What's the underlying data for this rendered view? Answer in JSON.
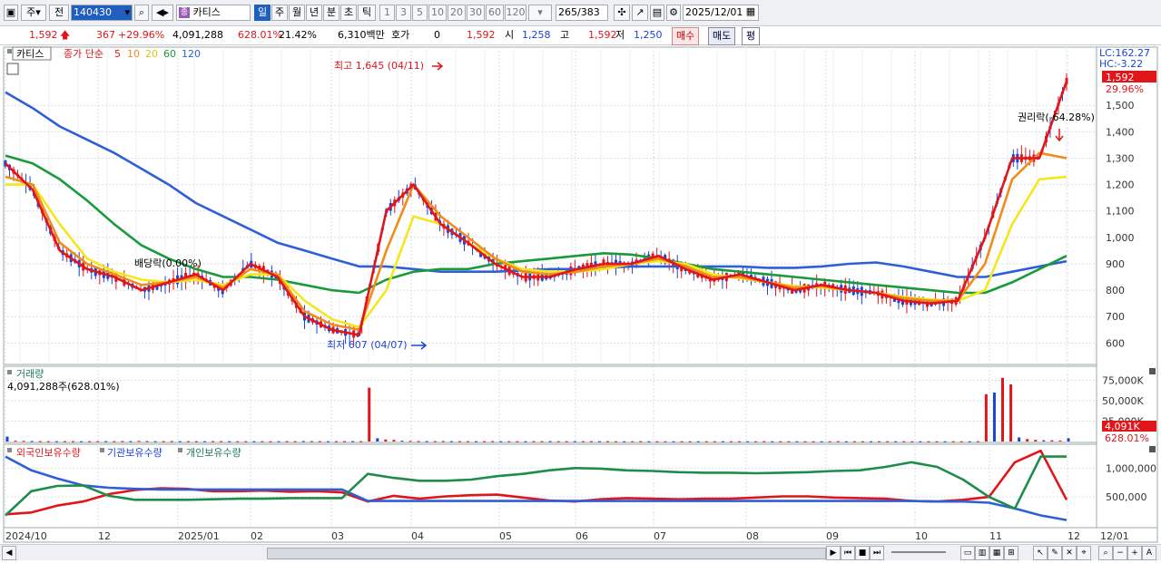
{
  "toolbar": {
    "mode1": "주",
    "mode2": "전",
    "code": "140430",
    "name": "카티스",
    "periods": [
      "일",
      "주",
      "월",
      "년",
      "분",
      "초",
      "틱"
    ],
    "active_period": "일",
    "intervals": [
      "1",
      "3",
      "5",
      "10",
      "20",
      "30",
      "60",
      "120"
    ],
    "range": "265",
    "total": "/383",
    "date": "2025/12/01"
  },
  "info": {
    "price": "1,592",
    "change": "367",
    "change_pct": "+29.96%",
    "volume": "4,091,288",
    "volume_pct": "628.01%",
    "turnover": "21.42%",
    "amount": "6,310백만",
    "hoga_label": "호가",
    "hoga_value": "0",
    "price2": "1,592",
    "open_label": "시",
    "open": "1,258",
    "high_label": "고",
    "high": "1,592",
    "low_label": "저",
    "low": "1,250",
    "buy": "매수",
    "sell": "매도",
    "eval": "평"
  },
  "chart_data": [
    {
      "type": "line",
      "title": "카티스",
      "legend": [
        "종가 단순",
        "5",
        "10",
        "20",
        "60",
        "120"
      ],
      "x_labels": [
        "2024/10",
        "12",
        "2025/01",
        "02",
        "03",
        "04",
        "05",
        "06",
        "07",
        "08",
        "09",
        "10",
        "11",
        "12",
        "12/01"
      ],
      "y_ticks": [
        600,
        700,
        800,
        900,
        1000,
        1100,
        1200,
        1300,
        1400,
        1500
      ],
      "ylim": [
        560,
        1700
      ],
      "series": [
        {
          "name": "5",
          "color": "#e0161b",
          "values": [
            1280,
            1180,
            950,
            880,
            850,
            800,
            830,
            860,
            800,
            900,
            850,
            700,
            650,
            630,
            1100,
            1200,
            1050,
            980,
            900,
            850,
            850,
            880,
            900,
            900,
            930,
            880,
            840,
            860,
            830,
            800,
            820,
            800,
            790,
            760,
            750,
            760,
            1000,
            1300,
            1300,
            1592
          ]
        },
        {
          "name": "10",
          "color": "#f08c1a",
          "values": [
            1230,
            1200,
            980,
            900,
            860,
            820,
            830,
            850,
            810,
            880,
            860,
            720,
            670,
            650,
            950,
            1200,
            1080,
            1000,
            920,
            870,
            860,
            870,
            890,
            900,
            920,
            890,
            850,
            850,
            830,
            810,
            815,
            800,
            790,
            770,
            760,
            760,
            900,
            1220,
            1320,
            1300
          ]
        },
        {
          "name": "20",
          "color": "#f5e61e",
          "values": [
            1200,
            1200,
            1050,
            920,
            870,
            840,
            830,
            840,
            820,
            860,
            860,
            760,
            690,
            660,
            800,
            1080,
            1050,
            980,
            920,
            880,
            870,
            870,
            880,
            900,
            910,
            900,
            860,
            845,
            830,
            815,
            810,
            800,
            790,
            775,
            765,
            760,
            800,
            1050,
            1220,
            1230
          ]
        },
        {
          "name": "60",
          "color": "#1a9a3a",
          "values": [
            1310,
            1280,
            1220,
            1140,
            1050,
            970,
            920,
            880,
            850,
            850,
            840,
            820,
            800,
            790,
            840,
            870,
            880,
            880,
            900,
            910,
            920,
            930,
            940,
            935,
            920,
            900,
            880,
            870,
            860,
            850,
            840,
            830,
            820,
            810,
            800,
            790,
            790,
            830,
            880,
            930
          ]
        },
        {
          "name": "120",
          "color": "#2f5fd6",
          "values": [
            1550,
            1490,
            1420,
            1370,
            1320,
            1260,
            1200,
            1130,
            1080,
            1030,
            980,
            950,
            920,
            890,
            890,
            880,
            870,
            870,
            870,
            875,
            880,
            880,
            885,
            890,
            890,
            890,
            890,
            890,
            885,
            885,
            890,
            900,
            905,
            890,
            870,
            850,
            850,
            870,
            890,
            910
          ]
        }
      ],
      "annotations": {
        "high": "최고 1,645 (04/11)",
        "low": "최저 607 (04/07)",
        "dividend": "배당락(0.00%)",
        "rights": "권리락(-64.28%)"
      },
      "lc": "LC:162.27",
      "hc": "HC:-3.22",
      "last_price_tag": "1,592",
      "last_pct_tag": "29.96%"
    },
    {
      "type": "bar",
      "title": "거래량",
      "subtitle": "4,091,288주(628.01%)",
      "y_ticks": [
        "75,000K",
        "50,000K",
        "25,000K"
      ],
      "last_tag": "4,091K",
      "last_pct": "628.01%",
      "values": [
        6000,
        1000,
        800,
        600,
        500,
        400,
        400,
        500,
        500,
        400,
        400,
        400,
        500,
        500,
        600,
        500,
        800,
        600,
        400,
        500,
        600,
        400,
        500,
        400,
        400,
        500,
        500,
        400,
        300,
        400,
        400,
        400,
        300,
        400,
        500,
        400,
        600,
        500,
        500,
        400,
        400,
        500,
        500,
        500,
        66000,
        4000,
        2500,
        2000,
        1000,
        700,
        600,
        500,
        500,
        600,
        500,
        500,
        400,
        400,
        400,
        500,
        400,
        400,
        400,
        400,
        500,
        400,
        500,
        400,
        400,
        400,
        400,
        400,
        400,
        400,
        300,
        300,
        300,
        400,
        300,
        300,
        300,
        300,
        300,
        300,
        300,
        300,
        300,
        400,
        300,
        300,
        300,
        300,
        400,
        300,
        300,
        300,
        300,
        300,
        300,
        300,
        300,
        400,
        300,
        300,
        300,
        300,
        300,
        300,
        300,
        400,
        300,
        300,
        300,
        300,
        300,
        300,
        300,
        300,
        300,
        58000,
        60000,
        78000,
        70000,
        5000,
        3000,
        2000,
        1500,
        1500,
        1200,
        4091
      ]
    },
    {
      "type": "line",
      "title": "외국인보유수량",
      "legend": [
        "외국인보유수량",
        "기관보유수량",
        "개인보유수량"
      ],
      "y_ticks": [
        "1,000,000",
        "500,000"
      ],
      "series": [
        {
          "name": "외국인보유수량",
          "color": "#e0161b",
          "values": [
            200000,
            230000,
            350000,
            420000,
            550000,
            620000,
            650000,
            640000,
            600000,
            600000,
            610000,
            590000,
            600000,
            580000,
            420000,
            520000,
            470000,
            510000,
            530000,
            540000,
            490000,
            440000,
            420000,
            460000,
            480000,
            470000,
            460000,
            470000,
            470000,
            490000,
            510000,
            510000,
            490000,
            480000,
            470000,
            430000,
            420000,
            450000,
            500000,
            1100000,
            1300000,
            450000
          ]
        },
        {
          "name": "기관보유수량",
          "color": "#2f5fd6",
          "values": [
            1200000,
            960000,
            820000,
            700000,
            660000,
            640000,
            630000,
            630000,
            630000,
            630000,
            630000,
            630000,
            630000,
            630000,
            430000,
            430000,
            430000,
            430000,
            430000,
            430000,
            430000,
            430000,
            430000,
            430000,
            430000,
            430000,
            430000,
            430000,
            430000,
            430000,
            430000,
            430000,
            430000,
            430000,
            430000,
            430000,
            420000,
            420000,
            400000,
            300000,
            180000,
            100000
          ]
        },
        {
          "name": "개인보유수량",
          "color": "#1e8c4a",
          "values": [
            180000,
            600000,
            690000,
            700000,
            520000,
            450000,
            450000,
            450000,
            460000,
            470000,
            470000,
            480000,
            480000,
            480000,
            900000,
            830000,
            780000,
            780000,
            800000,
            860000,
            900000,
            960000,
            1000000,
            990000,
            960000,
            950000,
            930000,
            920000,
            920000,
            910000,
            920000,
            930000,
            950000,
            960000,
            1020000,
            1100000,
            1020000,
            800000,
            500000,
            300000,
            1200000,
            1200000
          ]
        }
      ]
    }
  ]
}
